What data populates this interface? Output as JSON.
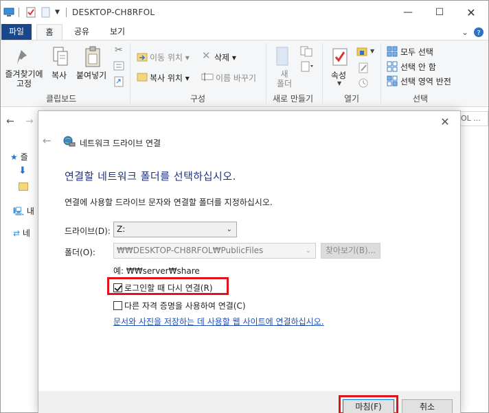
{
  "window": {
    "title": "DESKTOP-CH8RFOL"
  },
  "ribbon_tabs": {
    "file": "파일",
    "home": "홈",
    "share": "공유",
    "view": "보기"
  },
  "ribbon": {
    "clipboard": {
      "pin": "즐겨찾기에\n고정",
      "copy": "복사",
      "paste": "붙여넣기",
      "label": "클립보드"
    },
    "organize": {
      "move_to": "이동 위치",
      "copy_to": "복사 위치",
      "delete": "삭제",
      "rename": "이름 바꾸기",
      "label": "구성"
    },
    "new": {
      "new_folder": "새\n폴더",
      "label": "새로 만들기"
    },
    "open": {
      "properties": "속성",
      "label": "열기"
    },
    "select": {
      "select_all": "모두 선택",
      "select_none": "선택 안 함",
      "invert": "선택 영역 반전",
      "label": "선택"
    }
  },
  "address_tail": "OL ...",
  "navpane": {
    "favorites": "즐",
    "this_pc": "내",
    "network": "네"
  },
  "dialog": {
    "title": "네트워크 드라이브 연결",
    "heading": "연결할 네트워크 폴더를 선택하십시오.",
    "description": "연결에 사용할 드라이브 문자와 연결할 폴더를 지정하십시오.",
    "drive_label": "드라이브(D):",
    "drive_value": "Z:",
    "folder_label": "폴더(O):",
    "folder_value": "₩₩DESKTOP-CH8RFOL₩PublicFiles",
    "browse_label": "찾아보기(B)...",
    "example": "예: ₩₩server₩share",
    "reconnect_label": "로그인할 때 다시 연결(R)",
    "reconnect_checked": true,
    "credentials_label": "다른 자격 증명을 사용하여 연결(C)",
    "credentials_checked": false,
    "link_text": "문서와 사진을 저장하는 데 사용할 웹 사이트에 연결하십시오.",
    "finish_label": "마침(F)",
    "cancel_label": "취소"
  },
  "colors": {
    "file_tab": "#19478a",
    "highlight": "#e0121c",
    "heading": "#1e3287",
    "link": "#1d4fb8"
  }
}
